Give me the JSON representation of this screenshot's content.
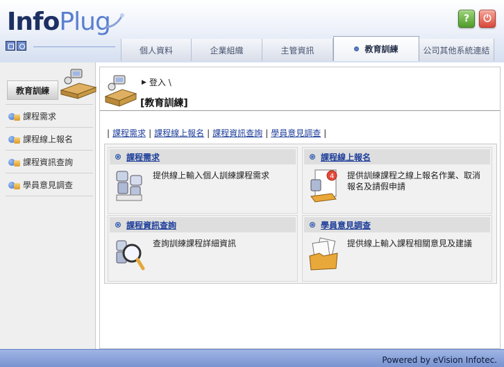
{
  "brand": {
    "part1": "Info",
    "part2": "Plug"
  },
  "header": {
    "help_label": "?",
    "power_label": "⏻"
  },
  "tabs": [
    {
      "label": "個人資料",
      "active": false
    },
    {
      "label": "企業組織",
      "active": false
    },
    {
      "label": "主管資訊",
      "active": false
    },
    {
      "label": "教育訓練",
      "active": true
    },
    {
      "label": "公司其他系統連結",
      "active": false
    }
  ],
  "sidebar": {
    "title": "教育訓練",
    "items": [
      {
        "label": "課程需求"
      },
      {
        "label": "課程線上報名"
      },
      {
        "label": "課程資訊查詢"
      },
      {
        "label": "學員意見調查"
      }
    ]
  },
  "main": {
    "breadcrumb": "登入 \\",
    "title": "[教育訓練]",
    "quicklinks": [
      "課程需求",
      "課程線上報名",
      "課程資訊查詢",
      "學員意見調查"
    ],
    "cards": [
      {
        "title": "課程需求",
        "description": "提供線上輸入個人訓練課程需求",
        "icon": "robots-icon"
      },
      {
        "title": "課程線上報名",
        "description": "提供訓練課程之線上報名作業、取消報名及請假申請",
        "icon": "signup-form-icon"
      },
      {
        "title": "課程資訊查詢",
        "description": "查詢訓練課程詳細資訊",
        "icon": "magnifier-icon"
      },
      {
        "title": "學員意見調查",
        "description": "提供線上輸入課程相關意見及建議",
        "icon": "survey-folder-icon"
      }
    ]
  },
  "footer": {
    "powered_by": "Powered by eVision Infotec."
  },
  "colors": {
    "link": "#1f3f9a",
    "footer": "#7893d0",
    "brand_dark": "#1d2f63",
    "brand_light": "#5a7fd0"
  }
}
